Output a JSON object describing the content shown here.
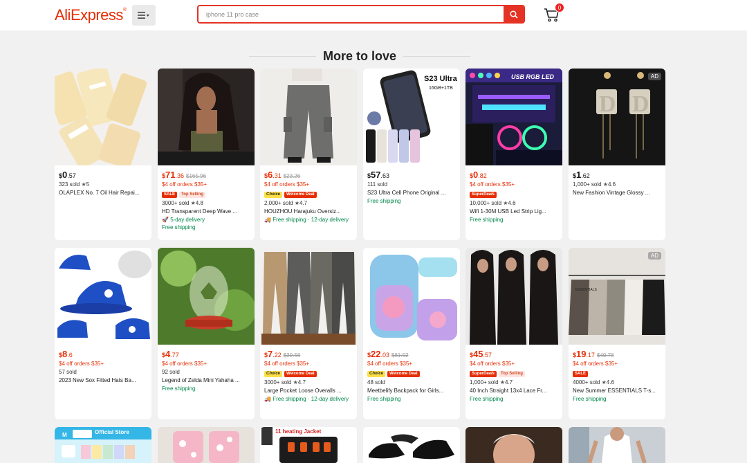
{
  "header": {
    "logo": "AliExpress",
    "search_placeholder": "iphone 11 pro case",
    "cart_count": "0"
  },
  "section_title": "More to love",
  "products": [
    {
      "price_cur": "$",
      "price_int": "0",
      "price_dec": ".57",
      "orig": "",
      "coupon": "",
      "tags": [],
      "sold": "323 sold",
      "rating": "5",
      "title": "OLAPLEX No. 7 Oil Hair Repai...",
      "ship1": "",
      "ship2": "",
      "ad": ""
    },
    {
      "price_cur": "$",
      "price_int": "71",
      "price_dec": ".36",
      "orig": "$165.96",
      "coupon": "$4 off orders $35+",
      "tags": [
        "SALE",
        "Top Selling"
      ],
      "sold": "3000+ sold",
      "rating": "4.8",
      "title": "HD Transparent Deep Wave ...",
      "ship1": "5-day delivery",
      "ship2": "Free shipping",
      "ad": ""
    },
    {
      "price_cur": "$",
      "price_int": "6",
      "price_dec": ".31",
      "orig": "$23.26",
      "coupon": "$4 off orders $35+",
      "tags": [
        "Choice",
        "Welcome Deal"
      ],
      "sold": "2,000+ sold",
      "rating": "4.7",
      "title": "HOUZHOU Harajuku Oversiz...",
      "ship1": "Free shipping · 12-day delivery",
      "ship2": "",
      "ad": ""
    },
    {
      "price_cur": "$",
      "price_int": "57",
      "price_dec": ".63",
      "orig": "",
      "coupon": "",
      "tags": [],
      "sold": "111 sold",
      "rating": "",
      "title": "S23 Ultra Cell Phone Original ...",
      "ship1": "Free shipping",
      "ship2": "",
      "ad": "",
      "img_text": "S23 Ultra",
      "img_sub": "16GB+1TB"
    },
    {
      "price_cur": "$",
      "price_int": "0",
      "price_dec": ".82",
      "orig": "",
      "coupon": "$4 off orders $35+",
      "tags": [
        "SuperDeals"
      ],
      "sold": "10,000+ sold",
      "rating": "4.6",
      "title": "Wifi 1-30M USB Led Strip Lig...",
      "ship1": "Free shipping",
      "ship2": "",
      "ad": "",
      "img_text": "USB RGB LED"
    },
    {
      "price_cur": "$",
      "price_int": "1",
      "price_dec": ".62",
      "orig": "",
      "coupon": "",
      "tags": [],
      "sold": "1,000+ sold",
      "rating": "4.6",
      "title": "New Fashion Vintage Glossy ...",
      "ship1": "",
      "ship2": "",
      "ad": "AD"
    },
    {
      "price_cur": "$",
      "price_int": "8",
      "price_dec": ".6",
      "orig": "",
      "coupon": "$4 off orders $35+",
      "tags": [],
      "sold": "57 sold",
      "rating": "",
      "title": "2023 New Sox Fitted Hats Ba...",
      "ship1": "",
      "ship2": "",
      "ad": ""
    },
    {
      "price_cur": "$",
      "price_int": "4",
      "price_dec": ".77",
      "orig": "",
      "coupon": "$4 off orders $35+",
      "tags": [],
      "sold": "92 sold",
      "rating": "",
      "title": "Legend of Zelda Mini Yahaha ...",
      "ship1": "Free shipping",
      "ship2": "",
      "ad": ""
    },
    {
      "price_cur": "$",
      "price_int": "7",
      "price_dec": ".22",
      "orig": "$30.56",
      "coupon": "$4 off orders $35+",
      "tags": [
        "Choice",
        "Welcome Deal"
      ],
      "sold": "3000+ sold",
      "rating": "4.7",
      "title": "Large Pocket Loose Overalls ...",
      "ship1": "Free shipping · 12-day delivery",
      "ship2": "",
      "ad": ""
    },
    {
      "price_cur": "$",
      "price_int": "22",
      "price_dec": ".03",
      "orig": "$81.92",
      "coupon": "$4 off orders $35+",
      "tags": [
        "Choice",
        "Welcome Deal"
      ],
      "sold": "48 sold",
      "rating": "",
      "title": "Meetbelify Backpack for Girls...",
      "ship1": "Free shipping",
      "ship2": "",
      "ad": ""
    },
    {
      "price_cur": "$",
      "price_int": "45",
      "price_dec": ".57",
      "orig": "",
      "coupon": "$4 off orders $35+",
      "tags": [
        "SuperDeals",
        "Top Selling"
      ],
      "sold": "1,000+ sold",
      "rating": "4.7",
      "title": "40 Inch Straight 13x4 Lace Fr...",
      "ship1": "Free shipping",
      "ship2": "",
      "ad": ""
    },
    {
      "price_cur": "$",
      "price_int": "19",
      "price_dec": ".17",
      "orig": "$40.78",
      "coupon": "$4 off orders $35+",
      "tags": [
        "SALE"
      ],
      "sold": "4000+ sold",
      "rating": "4.6",
      "title": "New Summer ESSENTIALS T-s...",
      "ship1": "Free shipping",
      "ship2": "",
      "ad": "AD",
      "img_text": "ESSENTIALS"
    }
  ],
  "partial_row": {
    "store_label": "Official Store",
    "heating_label": "11 heating Jacket"
  },
  "colors": {
    "brand": "#e62e04",
    "free_shipping": "#00864b",
    "choice": "#fde047"
  }
}
